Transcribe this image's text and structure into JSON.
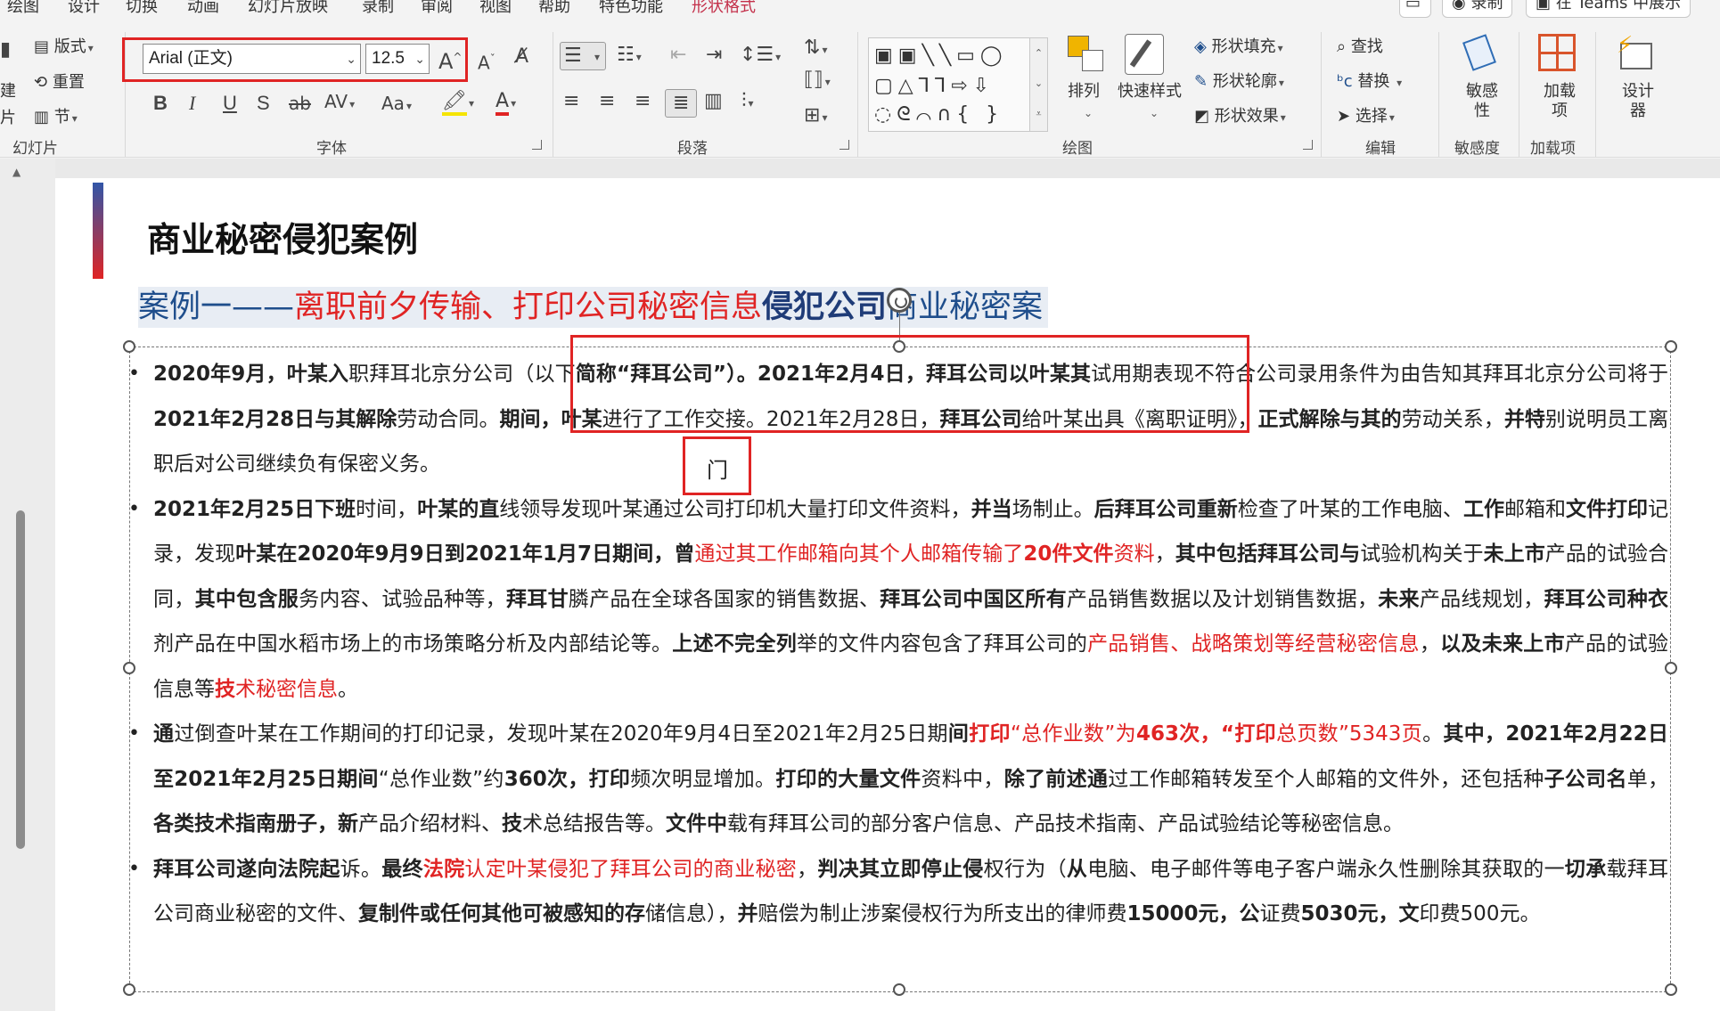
{
  "menu": {
    "tabs": [
      "绘图",
      "设计",
      "切换",
      "动画",
      "幻灯片放映",
      "录制",
      "审阅",
      "视图",
      "帮助",
      "特色功能",
      "形状格式"
    ],
    "active_tab": "形状格式",
    "record_label": "录制",
    "teams_label": "在 Teams 中展示"
  },
  "ribbon": {
    "slides_group": {
      "label": "幻灯片",
      "layout": "版式",
      "reset": "重置",
      "section": "节"
    },
    "font_group": {
      "label": "字体",
      "font_name": "Arial (正文)",
      "font_size": "12.5",
      "bold": "B",
      "italic": "I",
      "underline": "U",
      "shadow": "S",
      "strike": "ab",
      "spacing": "AV",
      "case": "Aa",
      "grow": "A",
      "shrink": "A"
    },
    "paragraph_group": {
      "label": "段落"
    },
    "drawing_group": {
      "label": "绘图",
      "arrange": "排列",
      "quick_styles": "快速样式",
      "shape_fill": "形状填充",
      "shape_outline": "形状轮廓",
      "shape_effects": "形状效果"
    },
    "editing_group": {
      "label": "编辑",
      "find": "查找",
      "replace": "替换",
      "select": "选择"
    },
    "sensitivity_group": {
      "label": "敏感度",
      "button": "敏感性"
    },
    "addins_group": {
      "label": "加载项",
      "button": "加载项"
    },
    "designer": {
      "button": "设计器"
    }
  },
  "slide": {
    "title": "商业秘密侵犯案例",
    "case_title": {
      "p1": "案例一——",
      "p2": "离职前夕传输、打印公司秘密信息",
      "p3": "侵犯公司",
      "p4": "商业秘密案"
    },
    "bullets": [
      {
        "parts": [
          {
            "t": "2020年9月，叶某入",
            "s": "b"
          },
          {
            "t": "职拜耳北京分公司（以下",
            "s": ""
          },
          {
            "t": "简称“拜耳公司”）。2021年2月4日，拜耳公司以叶某其",
            "s": "b"
          },
          {
            "t": "试用期表现不符合公司录用条件为由告知其拜耳北京分公司将于",
            "s": ""
          },
          {
            "t": "2021年2月28日与其解除",
            "s": "b"
          },
          {
            "t": "劳动合同。",
            "s": ""
          },
          {
            "t": "期间，叶某",
            "s": "b"
          },
          {
            "t": "进行了工作交接。2021年2月28日，",
            "s": ""
          },
          {
            "t": "拜耳公司",
            "s": "b"
          },
          {
            "t": "给叶某出具《离职证明》，",
            "s": ""
          },
          {
            "t": "正式解除与其的",
            "s": "b"
          },
          {
            "t": "劳动关系，",
            "s": ""
          },
          {
            "t": "并特",
            "s": "b"
          },
          {
            "t": "别说明员工离职后对公司继续负有保密义务。",
            "s": ""
          }
        ]
      },
      {
        "parts": [
          {
            "t": "2021年2月25日下班",
            "s": "b"
          },
          {
            "t": "时间，",
            "s": ""
          },
          {
            "t": "叶某的直",
            "s": "b"
          },
          {
            "t": "线领导发现叶某通过公司打印机大量打印文件资料，",
            "s": ""
          },
          {
            "t": "并当",
            "s": "b"
          },
          {
            "t": "场制止。",
            "s": ""
          },
          {
            "t": "后拜耳公司重新",
            "s": "b"
          },
          {
            "t": "检查了叶某的工作电脑、",
            "s": ""
          },
          {
            "t": "工作",
            "s": "b"
          },
          {
            "t": "邮箱和",
            "s": ""
          },
          {
            "t": "文件打印",
            "s": "b"
          },
          {
            "t": "记录，发现",
            "s": ""
          },
          {
            "t": "叶某在2020年9月9日到2021年1月7日期间，",
            "s": "b"
          },
          {
            "t": "曾",
            "s": "b"
          },
          {
            "t": "通过其工作邮箱向其个人邮箱传输了",
            "s": "r"
          },
          {
            "t": "20件文件",
            "s": "r b"
          },
          {
            "t": "资料",
            "s": "r"
          },
          {
            "t": "，",
            "s": ""
          },
          {
            "t": "其中包括拜耳公司与",
            "s": "b"
          },
          {
            "t": "试验机构关于",
            "s": ""
          },
          {
            "t": "未上市",
            "s": "b"
          },
          {
            "t": "产品的试验合同，",
            "s": ""
          },
          {
            "t": "其中包含服",
            "s": "b"
          },
          {
            "t": "务内容、试验品种等，",
            "s": ""
          },
          {
            "t": "拜耳甘",
            "s": "b"
          },
          {
            "t": "膦产品在全球各国家的销售数据、",
            "s": ""
          },
          {
            "t": "拜耳公司中国区所有",
            "s": "b"
          },
          {
            "t": "产品销售数据以及计划销售数据，",
            "s": ""
          },
          {
            "t": "未来",
            "s": "b"
          },
          {
            "t": "产品线规划，",
            "s": ""
          },
          {
            "t": "拜耳公司种衣",
            "s": "b"
          },
          {
            "t": "剂产品在中国水稻市场上的市场策略分析及内部结论等。",
            "s": ""
          },
          {
            "t": "上述不完全列",
            "s": "b"
          },
          {
            "t": "举的文件内容包含了拜耳公司的",
            "s": ""
          },
          {
            "t": "产品销售、战略策划等经营秘密信息",
            "s": "r"
          },
          {
            "t": "，",
            "s": ""
          },
          {
            "t": "以及未来上市",
            "s": "b"
          },
          {
            "t": "产品的试验信息等",
            "s": ""
          },
          {
            "t": "技",
            "s": "r b"
          },
          {
            "t": "术秘密信息",
            "s": "r"
          },
          {
            "t": "。",
            "s": ""
          }
        ]
      },
      {
        "parts": [
          {
            "t": "通",
            "s": "b"
          },
          {
            "t": "过倒查叶某在工作期间的打印记录，发现叶某在2020年9月4日至2021年2月25日期",
            "s": ""
          },
          {
            "t": "间",
            "s": "b"
          },
          {
            "t": "打印",
            "s": "r b"
          },
          {
            "t": "“总作业数”为",
            "s": "r"
          },
          {
            "t": "463次，“打印",
            "s": "r b"
          },
          {
            "t": "总页数”5343页",
            "s": "r"
          },
          {
            "t": "。",
            "s": ""
          },
          {
            "t": "其中，2021年2月22日至2021年2月25日期间",
            "s": "b"
          },
          {
            "t": "“总作业数”约",
            "s": ""
          },
          {
            "t": "360次，",
            "s": "b"
          },
          {
            "t": "打印",
            "s": "b"
          },
          {
            "t": "频次明显增加。",
            "s": ""
          },
          {
            "t": "打印的大量文件",
            "s": "b"
          },
          {
            "t": "资料中，",
            "s": ""
          },
          {
            "t": "除了前述通",
            "s": "b"
          },
          {
            "t": "过工作邮箱转发至个人邮箱的文件外，还包括种",
            "s": ""
          },
          {
            "t": "子公司名",
            "s": "b"
          },
          {
            "t": "单，",
            "s": ""
          },
          {
            "t": "各类技术指南册子，",
            "s": "b"
          },
          {
            "t": "新",
            "s": "b"
          },
          {
            "t": "产品介绍材料、",
            "s": ""
          },
          {
            "t": "技",
            "s": "b"
          },
          {
            "t": "术总结报告等。",
            "s": ""
          },
          {
            "t": "文件中",
            "s": "b"
          },
          {
            "t": "载有拜耳公司的部分客户信息、产品技术指南、产品试验结论等秘密信息。",
            "s": ""
          }
        ]
      },
      {
        "parts": [
          {
            "t": "拜耳公司遂向法院起",
            "s": "b"
          },
          {
            "t": "诉。",
            "s": ""
          },
          {
            "t": "最终",
            "s": "b"
          },
          {
            "t": "法院",
            "s": "r b"
          },
          {
            "t": "认定叶某侵犯了拜耳公司的商业秘密",
            "s": "r"
          },
          {
            "t": "，",
            "s": ""
          },
          {
            "t": "判决其立即停止侵",
            "s": "b"
          },
          {
            "t": "权行为（",
            "s": ""
          },
          {
            "t": "从",
            "s": "b"
          },
          {
            "t": "电脑、电子邮件等电子客户端永久性删除其获取的一",
            "s": ""
          },
          {
            "t": "切承",
            "s": "b"
          },
          {
            "t": "载拜耳公司商业秘密的文件、",
            "s": ""
          },
          {
            "t": "复制件或任何其他可被感知的存",
            "s": "b"
          },
          {
            "t": "储信息），",
            "s": ""
          },
          {
            "t": "并",
            "s": "b"
          },
          {
            "t": "赔偿为制止涉案侵权行为所支出的律师费",
            "s": ""
          },
          {
            "t": "15000元，",
            "s": "b"
          },
          {
            "t": "公",
            "s": "b"
          },
          {
            "t": "证费",
            "s": ""
          },
          {
            "t": "5030元，",
            "s": "b"
          },
          {
            "t": "文",
            "s": "b"
          },
          {
            "t": "印费500元。",
            "s": ""
          }
        ]
      }
    ],
    "stray_char": "门"
  },
  "colors": {
    "accent_red": "#e02424",
    "title_blue": "#1f4e8c",
    "active_tab": "#c4314b"
  }
}
